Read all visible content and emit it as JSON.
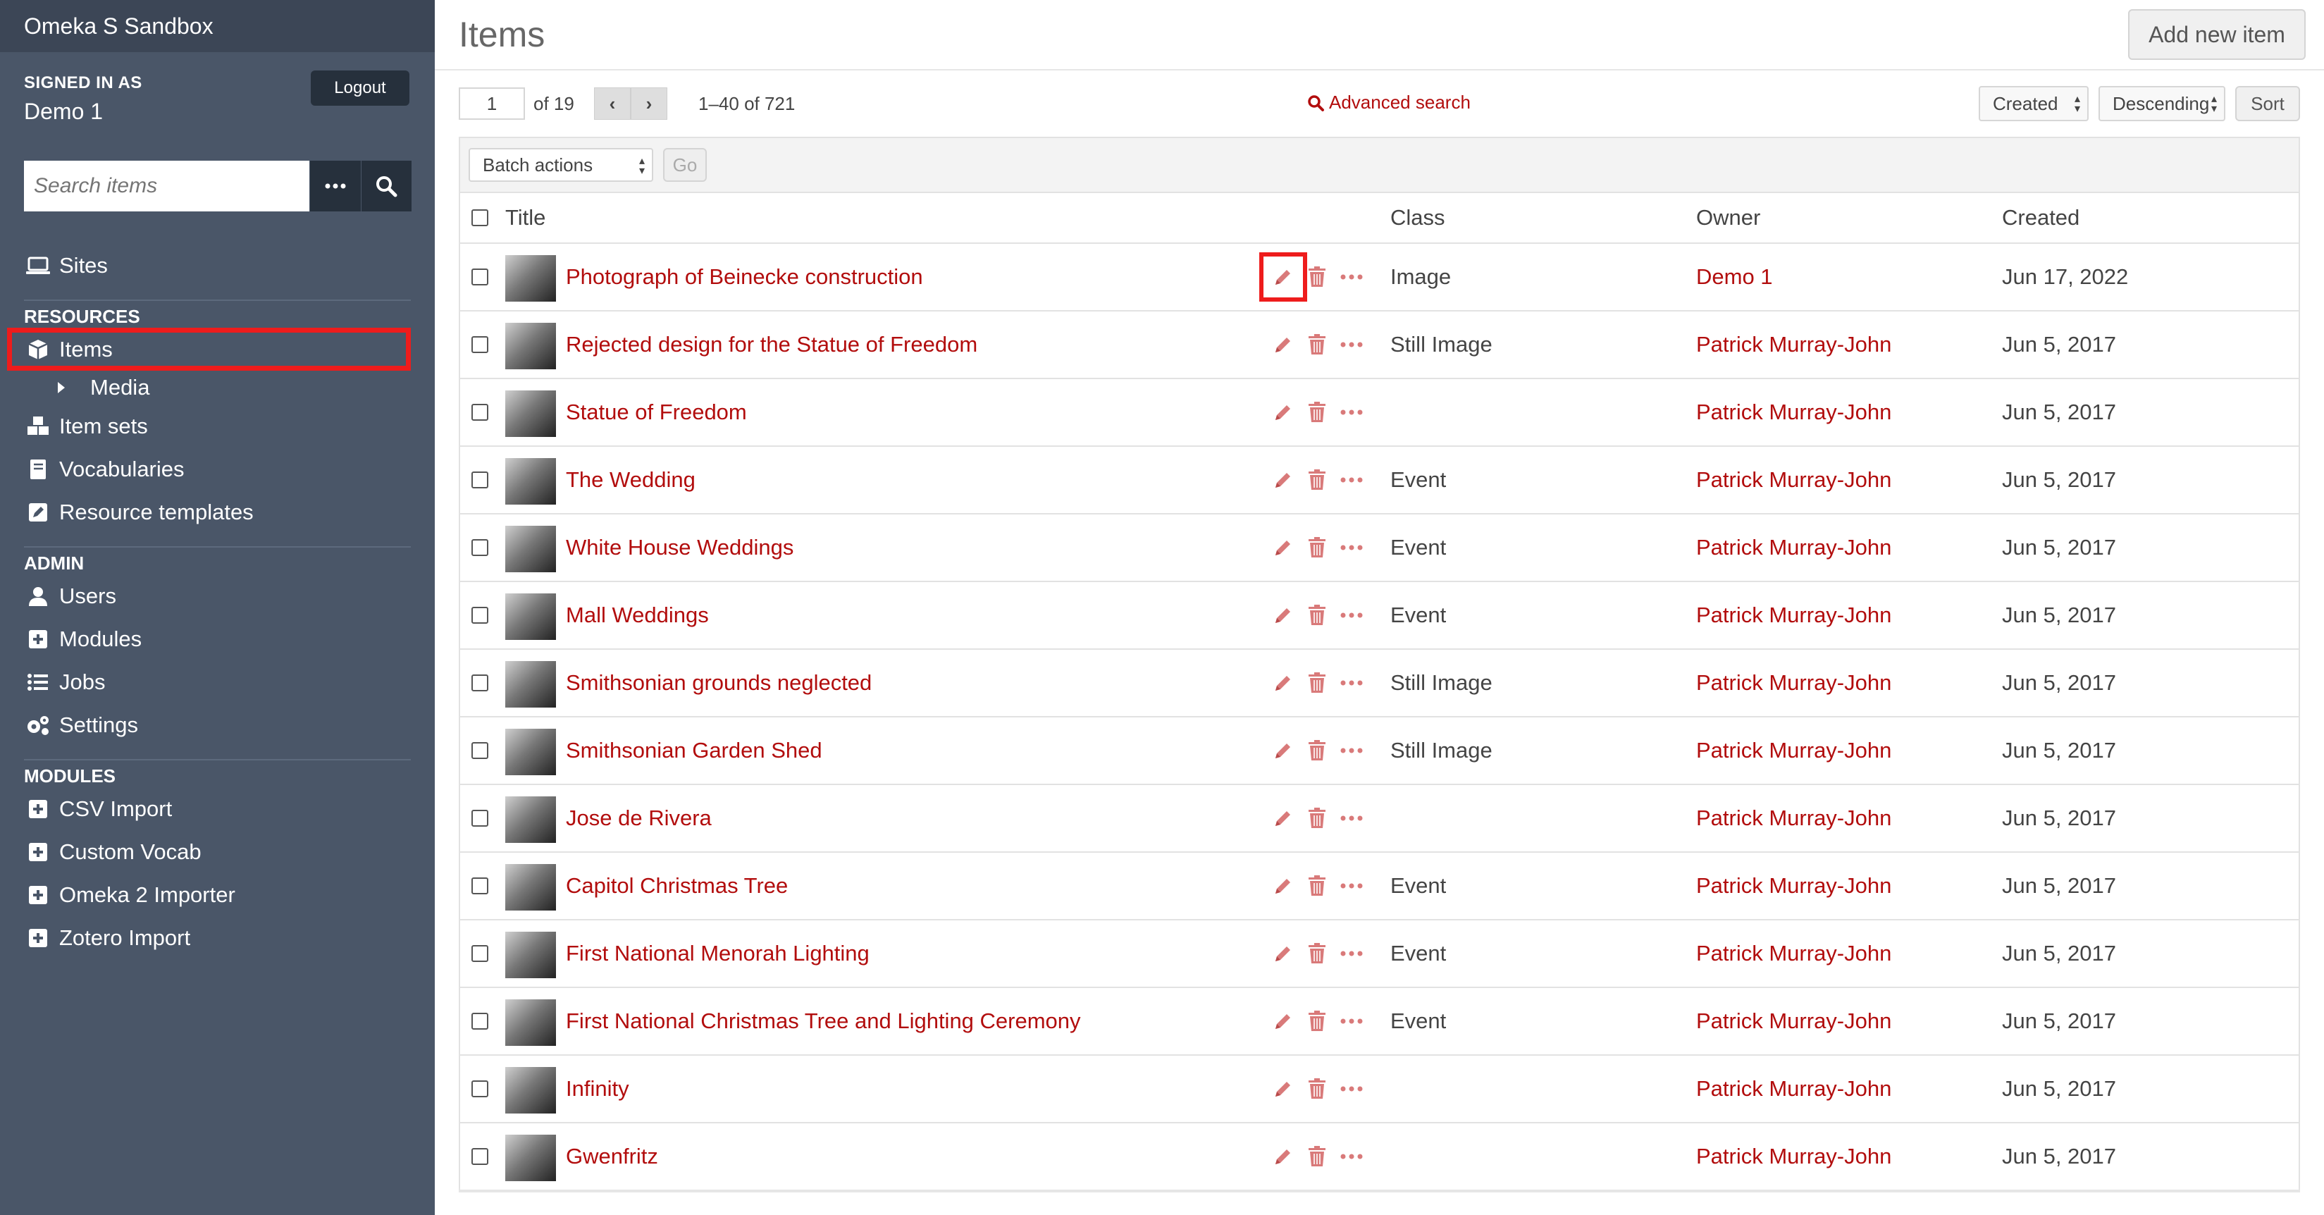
{
  "app": {
    "title": "Omeka S Sandbox"
  },
  "user": {
    "signed_in_label": "SIGNED IN AS",
    "name": "Demo 1",
    "logout": "Logout"
  },
  "search": {
    "placeholder": "Search items"
  },
  "nav": {
    "sites": "Sites",
    "resources_head": "RESOURCES",
    "items": "Items",
    "media": "Media",
    "item_sets": "Item sets",
    "vocabularies": "Vocabularies",
    "resource_templates": "Resource templates",
    "admin_head": "ADMIN",
    "users": "Users",
    "modules": "Modules",
    "jobs": "Jobs",
    "settings": "Settings",
    "modules_head": "MODULES",
    "csv_import": "CSV Import",
    "custom_vocab": "Custom Vocab",
    "omeka2_importer": "Omeka 2 Importer",
    "zotero_import": "Zotero Import"
  },
  "page": {
    "title": "Items",
    "add_button": "Add new item"
  },
  "pagination": {
    "page": "1",
    "of": "of 19",
    "range": "1–40 of 721",
    "prev": "‹",
    "next": "›"
  },
  "advanced_search": "Advanced search",
  "sort": {
    "field": "Created",
    "order": "Descending",
    "button": "Sort"
  },
  "batch": {
    "label": "Batch actions",
    "go": "Go"
  },
  "columns": {
    "title": "Title",
    "class": "Class",
    "owner": "Owner",
    "created": "Created"
  },
  "rows": [
    {
      "title": "Photograph of Beinecke construction",
      "class": "Image",
      "owner": "Demo 1",
      "created": "Jun 17, 2022"
    },
    {
      "title": "Rejected design for the Statue of Freedom",
      "class": "Still Image",
      "owner": "Patrick Murray-John",
      "created": "Jun 5, 2017"
    },
    {
      "title": "Statue of Freedom",
      "class": "",
      "owner": "Patrick Murray-John",
      "created": "Jun 5, 2017"
    },
    {
      "title": "The Wedding",
      "class": "Event",
      "owner": "Patrick Murray-John",
      "created": "Jun 5, 2017"
    },
    {
      "title": "White House Weddings",
      "class": "Event",
      "owner": "Patrick Murray-John",
      "created": "Jun 5, 2017"
    },
    {
      "title": "Mall Weddings",
      "class": "Event",
      "owner": "Patrick Murray-John",
      "created": "Jun 5, 2017"
    },
    {
      "title": "Smithsonian grounds neglected",
      "class": "Still Image",
      "owner": "Patrick Murray-John",
      "created": "Jun 5, 2017"
    },
    {
      "title": "Smithsonian Garden Shed",
      "class": "Still Image",
      "owner": "Patrick Murray-John",
      "created": "Jun 5, 2017"
    },
    {
      "title": "Jose de Rivera",
      "class": "",
      "owner": "Patrick Murray-John",
      "created": "Jun 5, 2017"
    },
    {
      "title": "Capitol Christmas Tree",
      "class": "Event",
      "owner": "Patrick Murray-John",
      "created": "Jun 5, 2017"
    },
    {
      "title": "First National Menorah Lighting",
      "class": "Event",
      "owner": "Patrick Murray-John",
      "created": "Jun 5, 2017"
    },
    {
      "title": "First National Christmas Tree and Lighting Ceremony",
      "class": "Event",
      "owner": "Patrick Murray-John",
      "created": "Jun 5, 2017"
    },
    {
      "title": "Infinity",
      "class": "",
      "owner": "Patrick Murray-John",
      "created": "Jun 5, 2017"
    },
    {
      "title": "Gwenfritz",
      "class": "",
      "owner": "Patrick Murray-John",
      "created": "Jun 5, 2017"
    }
  ],
  "colors": {
    "sidebar": "#4a5668",
    "brand_bar": "#3c4656",
    "link": "#b20d0d",
    "highlight": "#ee1c1c"
  }
}
